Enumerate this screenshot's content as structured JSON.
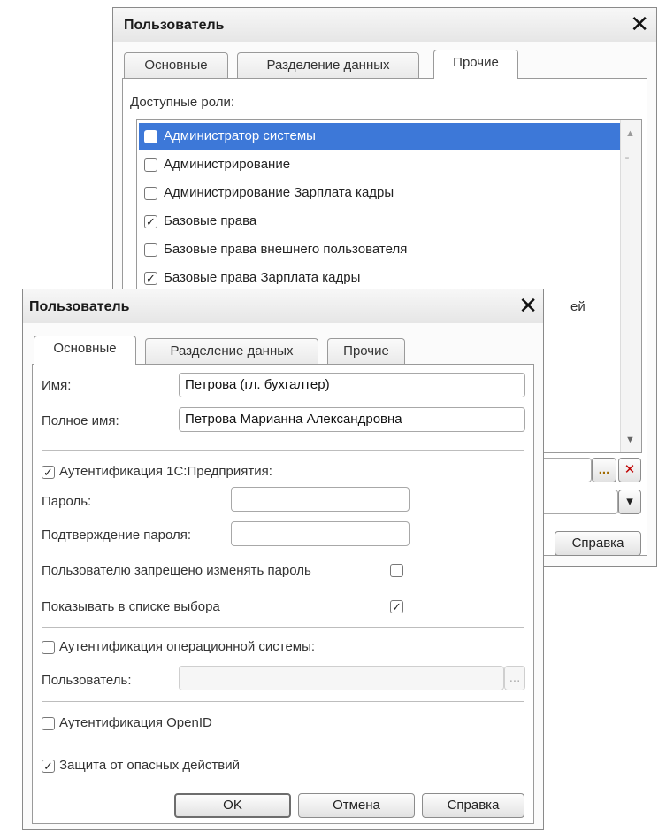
{
  "back_window": {
    "title": "Пользователь",
    "tabs": [
      "Основные",
      "Разделение данных",
      "Прочие"
    ],
    "roles_label": "Доступные роли:",
    "roles": [
      {
        "label": "Администратор системы",
        "checked": false,
        "selected": true
      },
      {
        "label": "Администрирование",
        "checked": false,
        "selected": false
      },
      {
        "label": "Администрирование Зарплата кадры",
        "checked": false,
        "selected": false
      },
      {
        "label": "Базовые права",
        "checked": true,
        "selected": false
      },
      {
        "label": "Базовые права внешнего пользователя",
        "checked": false,
        "selected": false
      },
      {
        "label": "Базовые права Зарплата кадры",
        "checked": true,
        "selected": false
      }
    ],
    "partial_text": "ей",
    "help_button": "Справка",
    "ellipsis": "...",
    "clear_glyph": "✕",
    "dropdown_glyph": "▾"
  },
  "front_window": {
    "title": "Пользователь",
    "tabs": [
      "Основные",
      "Разделение данных",
      "Прочие"
    ],
    "name_label": "Имя:",
    "name_value": "Петрова (гл. бухгалтер)",
    "fullname_label": "Полное имя:",
    "fullname_value": "Петрова Марианна Александровна",
    "auth_1c_label": "Аутентификация 1С:Предприятия:",
    "password_label": "Пароль:",
    "confirm_label": "Подтверждение пароля:",
    "forbid_change_label": "Пользователю запрещено изменять пароль",
    "show_in_list_label": "Показывать в списке выбора",
    "os_auth_label": "Аутентификация операционной системы:",
    "os_user_label": "Пользователь:",
    "os_user_ellipsis": "...",
    "openid_label": "Аутентификация OpenID",
    "protection_label": "Защита от опасных действий",
    "ok_button": "OK",
    "cancel_button": "Отмена",
    "help_button": "Справка"
  },
  "checkmark": "✓",
  "close_glyph": "✕"
}
